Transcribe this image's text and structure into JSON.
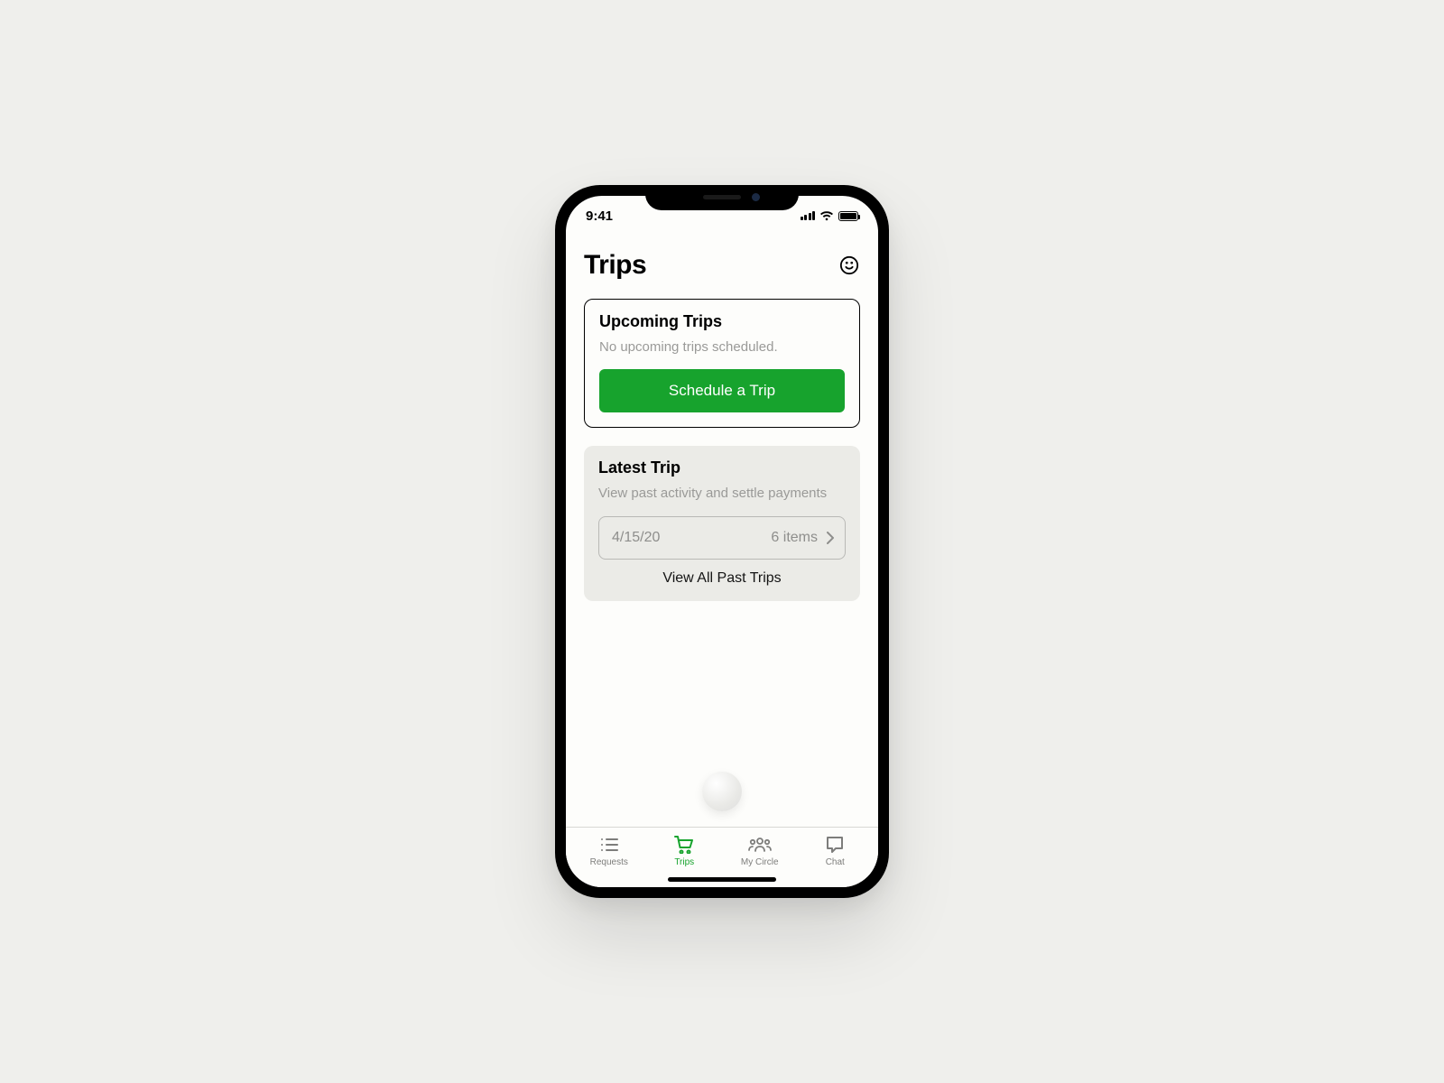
{
  "status_bar": {
    "time": "9:41"
  },
  "header": {
    "title": "Trips"
  },
  "upcoming": {
    "title": "Upcoming Trips",
    "empty_message": "No upcoming trips scheduled.",
    "cta": "Schedule a Trip"
  },
  "latest": {
    "title": "Latest Trip",
    "subtitle": "View past activity and settle payments",
    "row": {
      "date": "4/15/20",
      "items": "6 items"
    },
    "view_all": "View All Past Trips"
  },
  "tabs": {
    "requests": "Requests",
    "trips": "Trips",
    "circle": "My Circle",
    "chat": "Chat",
    "active": "trips"
  },
  "colors": {
    "accent": "#17a32d"
  }
}
